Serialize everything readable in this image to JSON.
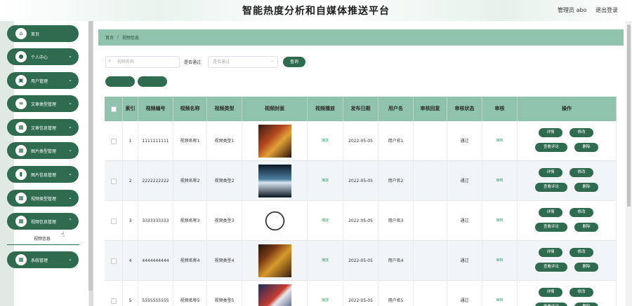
{
  "header": {
    "title": "智能热度分析和自媒体推送平台",
    "user": "管理员 abo",
    "logout": "退出登录"
  },
  "sidebar": {
    "items": [
      {
        "label": "首页",
        "icon": "home-icon",
        "chev": ""
      },
      {
        "label": "个人中心",
        "icon": "user-icon",
        "chev": "⌄"
      },
      {
        "label": "用户管理",
        "icon": "users-icon",
        "chev": "⌄"
      },
      {
        "label": "文章类型管理",
        "icon": "list-icon",
        "chev": "⌄"
      },
      {
        "label": "文章信息管理",
        "icon": "grid-icon",
        "chev": "⌄"
      },
      {
        "label": "图片类型管理",
        "icon": "grid-icon",
        "chev": "⌄"
      },
      {
        "label": "图片信息管理",
        "icon": "chart-icon",
        "chev": "⌄"
      },
      {
        "label": "视频类型管理",
        "icon": "grid-icon",
        "chev": "⌄"
      },
      {
        "label": "视频信息管理",
        "icon": "grid-icon",
        "chev": "⌃"
      },
      {
        "label": "系统管理",
        "icon": "grid-icon",
        "chev": "⌄"
      }
    ],
    "submenu_label": "视频信息"
  },
  "breadcrumb": {
    "home": "首页",
    "sep": "/",
    "current": "视频信息"
  },
  "search": {
    "placeholder": "视频名称",
    "filter_label": "是否通过",
    "filter_placeholder": "是否通过",
    "query_label": "查询"
  },
  "table": {
    "headers": [
      "索引",
      "视频编号",
      "视频名称",
      "视频类型",
      "视频封面",
      "视频播放",
      "发布日期",
      "用户名",
      "审核回复",
      "审核状态",
      "审核",
      "操作"
    ],
    "rows": [
      {
        "index": "1",
        "code": "1111111111",
        "name": "视频名称1",
        "type": "视频类型1",
        "play": "播放",
        "date": "2022-05-05",
        "user": "用户名1",
        "reply": "",
        "status": "通过",
        "audit": "审核"
      },
      {
        "index": "2",
        "code": "2222222222",
        "name": "视频名称2",
        "type": "视频类型2",
        "play": "播放",
        "date": "2022-05-05",
        "user": "用户名2",
        "reply": "",
        "status": "通过",
        "audit": "审核"
      },
      {
        "index": "3",
        "code": "3333333333",
        "name": "视频名称3",
        "type": "视频类型3",
        "play": "播放",
        "date": "2022-05-05",
        "user": "用户名3",
        "reply": "",
        "status": "通过",
        "audit": "审核"
      },
      {
        "index": "4",
        "code": "4444444444",
        "name": "视频名称4",
        "type": "视频类型4",
        "play": "播放",
        "date": "2022-05-05",
        "user": "用户名4",
        "reply": "",
        "status": "通过",
        "audit": "审核"
      },
      {
        "index": "5",
        "code": "5555555555",
        "name": "视频名称5",
        "type": "视频类型5",
        "play": "播放",
        "date": "2022-05-05",
        "user": "用户名5",
        "reply": "",
        "status": "通过",
        "audit": "审核"
      }
    ],
    "ops": {
      "detail": "详情",
      "edit": "修改",
      "comments": "查看评论",
      "delete": "删除"
    }
  },
  "colors": {
    "accent": "#2f6b4f",
    "header_bg": "#8fc3ad",
    "link": "#3c9a6d"
  }
}
